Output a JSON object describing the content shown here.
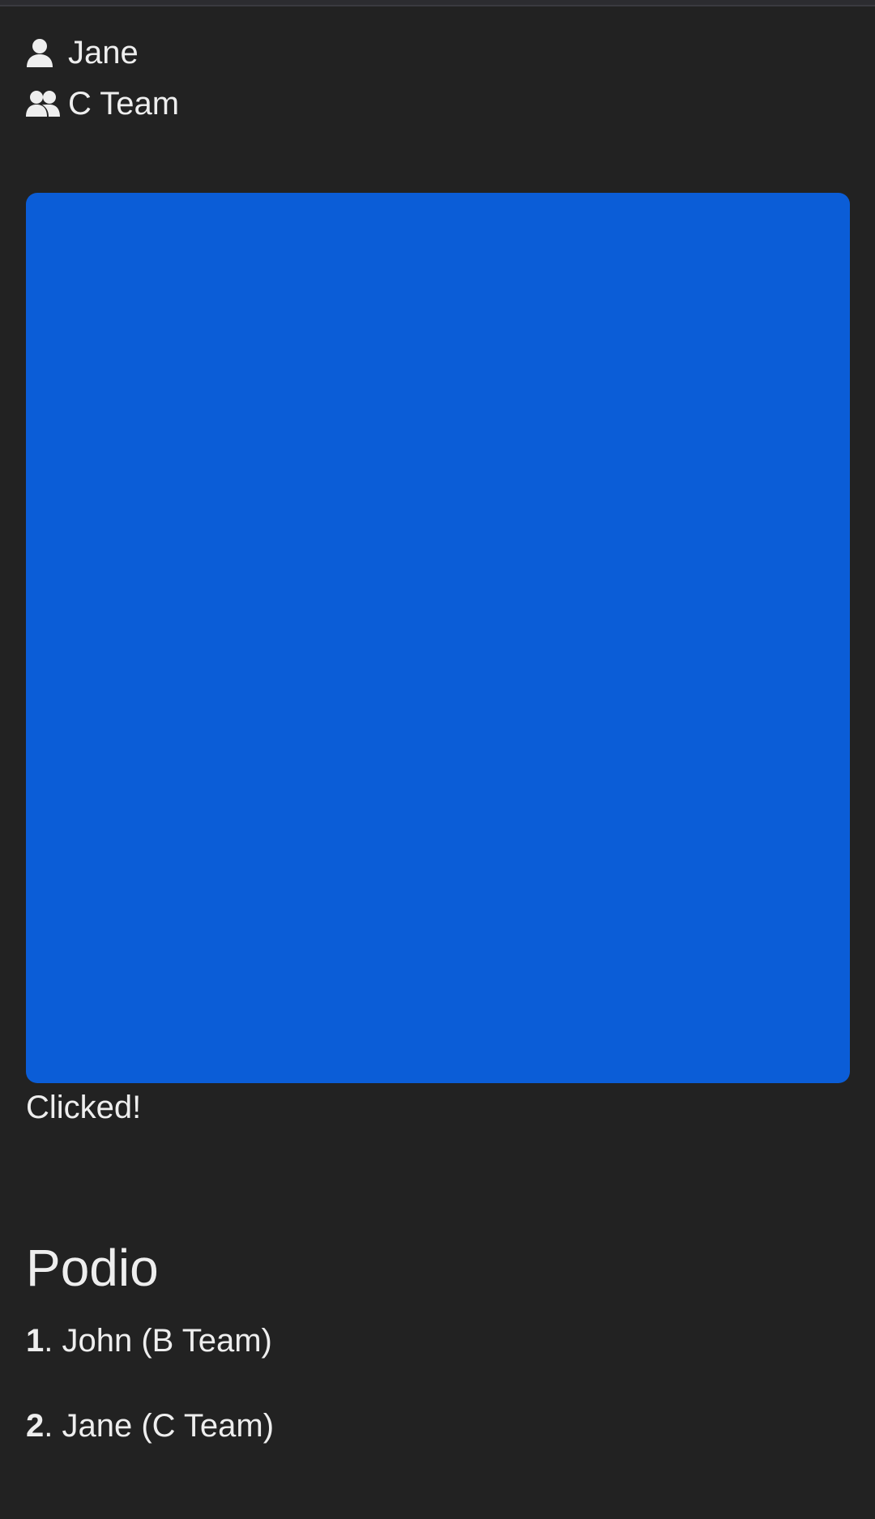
{
  "user": {
    "name": "Jane",
    "team": "C Team",
    "icons": {
      "user": "user-icon",
      "team": "users-icon"
    }
  },
  "main_button": {
    "color": "#0b5dd7",
    "status_text": "Clicked!"
  },
  "podio": {
    "title": "Podio",
    "entries": [
      {
        "rank": "1",
        "text": ". John (B Team)"
      },
      {
        "rank": "2",
        "text": ". Jane (C Team)"
      }
    ]
  },
  "colors": {
    "background": "#222222",
    "text": "#eeeeee",
    "accent": "#0b5dd7"
  }
}
